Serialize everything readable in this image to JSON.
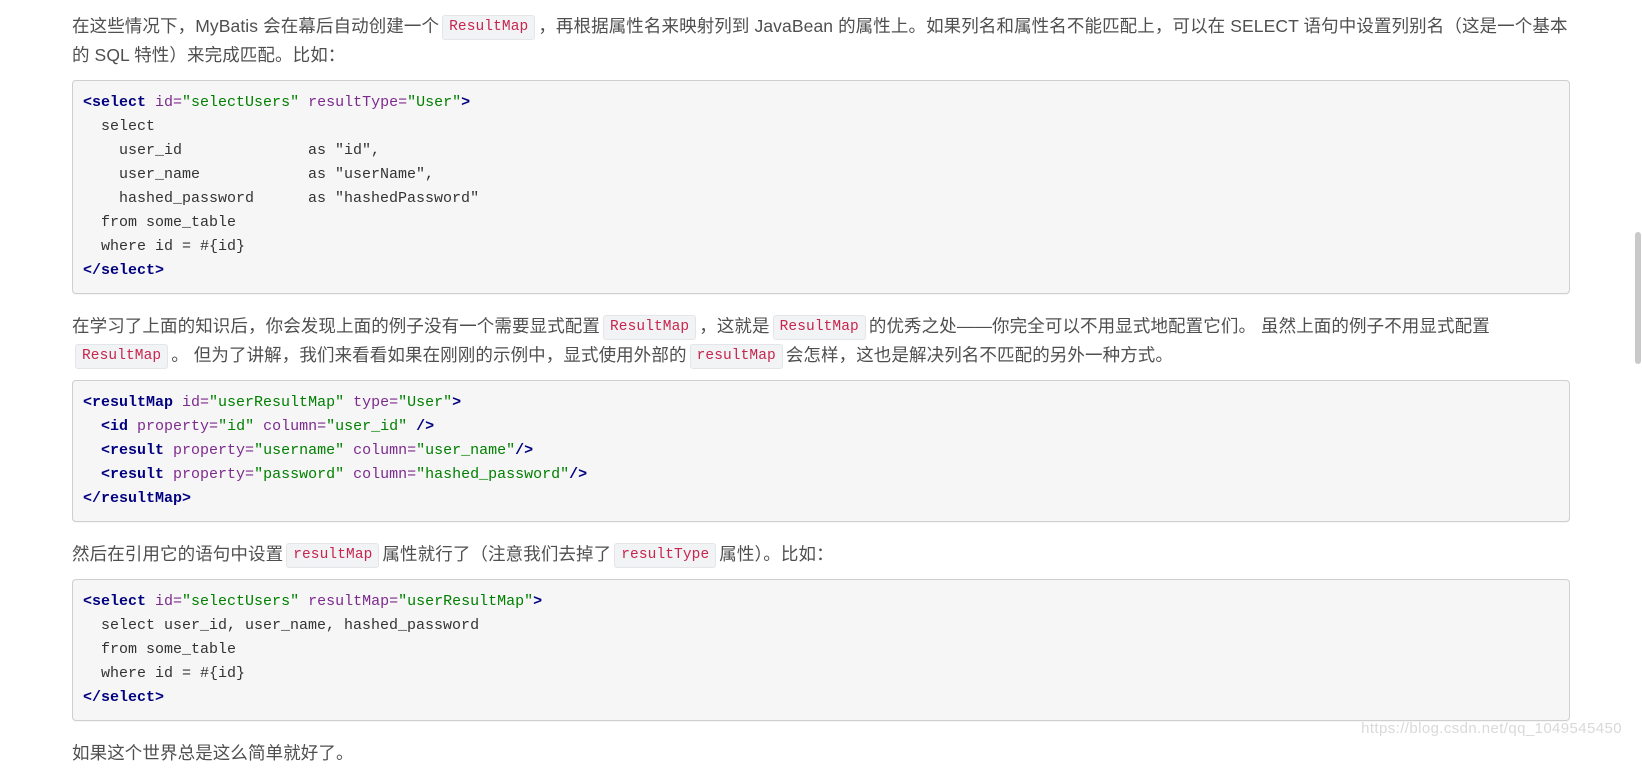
{
  "document": {
    "paragraph_1": {
      "seg_1": "在这些情况下，MyBatis 会在幕后自动创建一个",
      "chip_1": "ResultMap",
      "seg_2": "，再根据属性名来映射列到 JavaBean 的属性上。如果列名和属性名不能匹配上，可以在 SELECT 语句中设置列别名（这是一个基本的 SQL 特性）来完成匹配。比如："
    },
    "code_1": {
      "language": "xml",
      "lines": [
        [
          {
            "t": "tag",
            "v": "<select"
          },
          {
            "t": "plain",
            "v": " "
          },
          {
            "t": "attr",
            "v": "id="
          },
          {
            "t": "str",
            "v": "\"selectUsers\""
          },
          {
            "t": "plain",
            "v": " "
          },
          {
            "t": "attr",
            "v": "resultType="
          },
          {
            "t": "str",
            "v": "\"User\""
          },
          {
            "t": "tag",
            "v": ">"
          }
        ],
        [
          {
            "t": "plain",
            "v": "  select"
          }
        ],
        [
          {
            "t": "plain",
            "v": "    user_id              as \"id\","
          }
        ],
        [
          {
            "t": "plain",
            "v": "    user_name            as \"userName\","
          }
        ],
        [
          {
            "t": "plain",
            "v": "    hashed_password      as \"hashedPassword\""
          }
        ],
        [
          {
            "t": "plain",
            "v": "  from some_table"
          }
        ],
        [
          {
            "t": "plain",
            "v": "  where id = #{id}"
          }
        ],
        [
          {
            "t": "tag",
            "v": "</select>"
          }
        ]
      ]
    },
    "paragraph_2": {
      "seg_1": "在学习了上面的知识后，你会发现上面的例子没有一个需要显式配置",
      "chip_1": "ResultMap",
      "seg_2": "，这就是",
      "chip_2": "ResultMap",
      "seg_3": "的优秀之处——你完全可以不用显式地配置它们。 虽然上面的例子不用显式配置",
      "chip_3": "ResultMap",
      "seg_4": "。 但为了讲解，我们来看看如果在刚刚的示例中，显式使用外部的",
      "chip_4": "resultMap",
      "seg_5": "会怎样，这也是解决列名不匹配的另外一种方式。"
    },
    "code_2": {
      "language": "xml",
      "lines": [
        [
          {
            "t": "tag",
            "v": "<resultMap"
          },
          {
            "t": "plain",
            "v": " "
          },
          {
            "t": "attr",
            "v": "id="
          },
          {
            "t": "str",
            "v": "\"userResultMap\""
          },
          {
            "t": "plain",
            "v": " "
          },
          {
            "t": "attr",
            "v": "type="
          },
          {
            "t": "str",
            "v": "\"User\""
          },
          {
            "t": "tag",
            "v": ">"
          }
        ],
        [
          {
            "t": "plain",
            "v": "  "
          },
          {
            "t": "tag",
            "v": "<id"
          },
          {
            "t": "plain",
            "v": " "
          },
          {
            "t": "attr",
            "v": "property="
          },
          {
            "t": "str",
            "v": "\"id\""
          },
          {
            "t": "plain",
            "v": " "
          },
          {
            "t": "attr",
            "v": "column="
          },
          {
            "t": "str",
            "v": "\"user_id\""
          },
          {
            "t": "plain",
            "v": " "
          },
          {
            "t": "tag",
            "v": "/>"
          }
        ],
        [
          {
            "t": "plain",
            "v": "  "
          },
          {
            "t": "tag",
            "v": "<result"
          },
          {
            "t": "plain",
            "v": " "
          },
          {
            "t": "attr",
            "v": "property="
          },
          {
            "t": "str",
            "v": "\"username\""
          },
          {
            "t": "plain",
            "v": " "
          },
          {
            "t": "attr",
            "v": "column="
          },
          {
            "t": "str",
            "v": "\"user_name\""
          },
          {
            "t": "tag",
            "v": "/>"
          }
        ],
        [
          {
            "t": "plain",
            "v": "  "
          },
          {
            "t": "tag",
            "v": "<result"
          },
          {
            "t": "plain",
            "v": " "
          },
          {
            "t": "attr",
            "v": "property="
          },
          {
            "t": "str",
            "v": "\"password\""
          },
          {
            "t": "plain",
            "v": " "
          },
          {
            "t": "attr",
            "v": "column="
          },
          {
            "t": "str",
            "v": "\"hashed_password\""
          },
          {
            "t": "tag",
            "v": "/>"
          }
        ],
        [
          {
            "t": "tag",
            "v": "</resultMap>"
          }
        ]
      ]
    },
    "paragraph_3": {
      "seg_1": "然后在引用它的语句中设置",
      "chip_1": "resultMap",
      "seg_2": "属性就行了（注意我们去掉了",
      "chip_2": "resultType",
      "seg_3": "属性）。比如："
    },
    "code_3": {
      "language": "xml",
      "lines": [
        [
          {
            "t": "tag",
            "v": "<select"
          },
          {
            "t": "plain",
            "v": " "
          },
          {
            "t": "attr",
            "v": "id="
          },
          {
            "t": "str",
            "v": "\"selectUsers\""
          },
          {
            "t": "plain",
            "v": " "
          },
          {
            "t": "attr",
            "v": "resultMap="
          },
          {
            "t": "str",
            "v": "\"userResultMap\""
          },
          {
            "t": "tag",
            "v": ">"
          }
        ],
        [
          {
            "t": "plain",
            "v": "  select user_id, user_name, hashed_password"
          }
        ],
        [
          {
            "t": "plain",
            "v": "  from some_table"
          }
        ],
        [
          {
            "t": "plain",
            "v": "  where id = #{id}"
          }
        ],
        [
          {
            "t": "tag",
            "v": "</select>"
          }
        ]
      ]
    },
    "paragraph_4": {
      "seg_1": "如果这个世界总是这么简单就好了。"
    }
  },
  "watermark": {
    "text": "https://blog.csdn.net/qq_1049545450"
  },
  "colors": {
    "text": "#4f4f4f",
    "inline_code": "#c7254e",
    "inline_code_bg": "#f2f3f5",
    "code_bg": "#f6f6f6",
    "code_border": "#cfcfcf",
    "tag": "#000080",
    "attr": "#7d2a8f",
    "string": "#008000",
    "watermark": "#d9d9d9"
  }
}
